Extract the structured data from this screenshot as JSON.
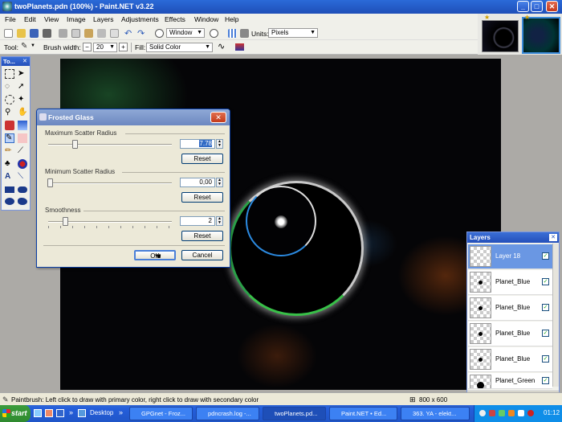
{
  "window": {
    "title": "twoPlanets.pdn (100%) - Paint.NET v3.22",
    "minimize": "_",
    "maximize": "□",
    "close": "✕"
  },
  "menu": [
    "File",
    "Edit",
    "View",
    "Image",
    "Layers",
    "Adjustments",
    "Effects",
    "Window",
    "Help"
  ],
  "toolbar1": {
    "zoom_mode": "Window",
    "units_label": "Units:",
    "units_value": "Pixels"
  },
  "toolbar2": {
    "tool_label": "Tool:",
    "brush_width_label": "Brush width:",
    "brush_width_value": "20",
    "fill_label": "Fill:",
    "fill_value": "Solid Color"
  },
  "tools_panel": {
    "title": "To..."
  },
  "dialog": {
    "title": "Frosted Glass",
    "max_scatter": {
      "label": "Maximum Scatter Radius",
      "value": "7.78",
      "level": 0.21,
      "reset": "Reset"
    },
    "min_scatter": {
      "label": "Minimum Scatter Radius",
      "value": "0,00",
      "level": 0.0,
      "reset": "Reset"
    },
    "smoothness": {
      "label": "Smoothness",
      "value": "2",
      "level": 0.13,
      "reset": "Reset"
    },
    "ok": "OK",
    "cancel": "Cancel"
  },
  "layers_panel": {
    "title": "Layers",
    "layers": [
      {
        "name": "Layer 18",
        "visible": "✓"
      },
      {
        "name": "Planet_Blue",
        "visible": "✓"
      },
      {
        "name": "Planet_Blue",
        "visible": "✓"
      },
      {
        "name": "Planet_Blue",
        "visible": "✓"
      },
      {
        "name": "Planet_Blue",
        "visible": "✓"
      },
      {
        "name": "Planet_Green",
        "visible": "✓"
      }
    ]
  },
  "status": {
    "hint": "Paintbrush: Left click to draw with primary color, right click to draw with secondary color",
    "image_size": "800 x 600"
  },
  "taskbar": {
    "start": "start",
    "desktop": "Desktop",
    "tasks": [
      "GPGnet - Froz...",
      "pdncrash.log -...",
      "twoPlanets.pd...",
      "Paint.NET • Ed...",
      "363. YA - elekt..."
    ],
    "clock": "01:12"
  },
  "colors": {
    "accent": "#316ac5",
    "title_bar": "#1f4fb8",
    "canvas": "#050507"
  }
}
